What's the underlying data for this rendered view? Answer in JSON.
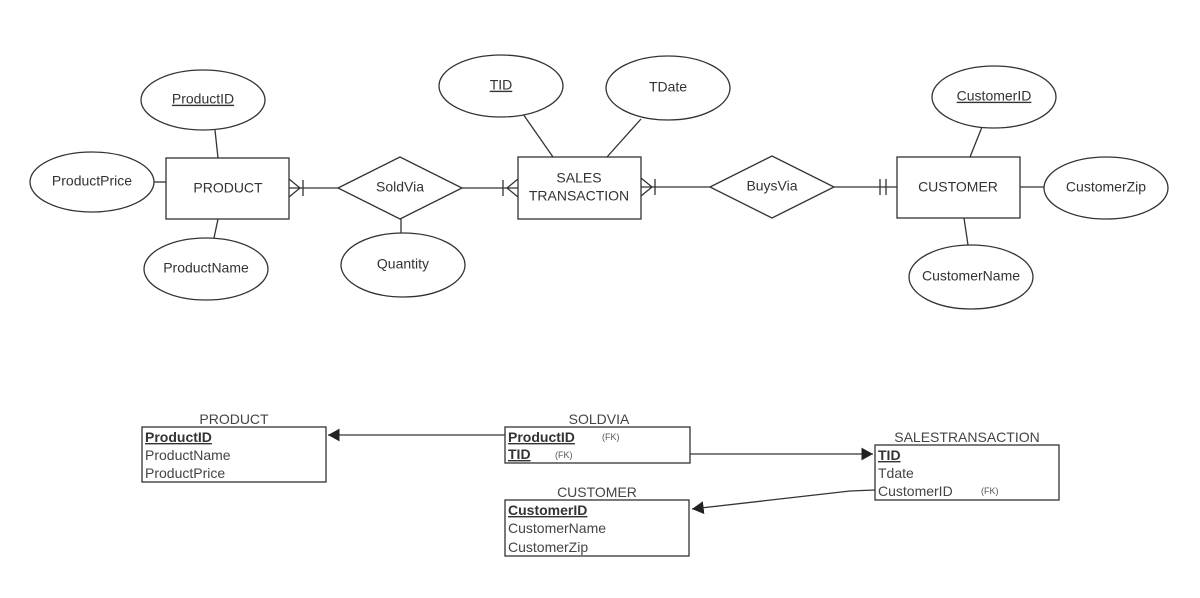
{
  "er": {
    "entities": {
      "product": "PRODUCT",
      "sales_line1": "SALES",
      "sales_line2": "TRANSACTION",
      "customer": "CUSTOMER"
    },
    "relationships": {
      "soldvia": "SoldVia",
      "buysvia": "BuysVia"
    },
    "attributes": {
      "product_id": "ProductID",
      "product_price": "ProductPrice",
      "product_name": "ProductName",
      "quantity": "Quantity",
      "tid": "TID",
      "tdate": "TDate",
      "customer_id": "CustomerID",
      "customer_zip": "CustomerZip",
      "customer_name": "CustomerName"
    }
  },
  "schema": {
    "product": {
      "title": "PRODUCT",
      "rows": [
        "ProductID",
        "ProductName",
        "ProductPrice"
      ]
    },
    "soldvia": {
      "title": "SOLDVIA",
      "rows": [
        "ProductID",
        "TID"
      ],
      "fk": "(FK)"
    },
    "salestransaction": {
      "title": "SALESTRANSACTION",
      "rows": [
        "TID",
        "Tdate",
        "CustomerID"
      ],
      "fk": "(FK)"
    },
    "customer": {
      "title": "CUSTOMER",
      "rows": [
        "CustomerID",
        "CustomerName",
        "CustomerZip"
      ]
    }
  }
}
